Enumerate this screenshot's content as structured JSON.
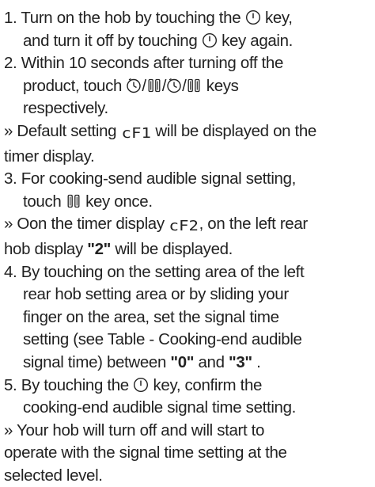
{
  "icons": {
    "power": "power-key-icon",
    "timer": "timer-key-icon",
    "lock": "lock-key-icon"
  },
  "codes": {
    "cf1": "cF1",
    "cf2": "cF2"
  },
  "step1": {
    "l1a": "1. Turn on the hob by touching the ",
    "l1b": " key,",
    "l2a": "and turn it off by touching ",
    "l2b": " key again."
  },
  "step2": {
    "l1": "2. Within 10 seconds after turning off the",
    "l2a": "product, touch ",
    "sep1": "/",
    "sep2": "/",
    "sep3": "/",
    "l2b": " keys",
    "l3": "respectively."
  },
  "note1": {
    "l1a": "» Default setting ",
    "l1b": " will be displayed on the",
    "l2": "timer display."
  },
  "step3": {
    "l1": "3. For cooking-send audible signal setting,",
    "l2a": "touch ",
    "l2b": " key once."
  },
  "note2": {
    "l1a": "» Oon the timer display ",
    "l1b": ", on the left rear",
    "l2a": "hob display ",
    "l2b": "\"2\"",
    "l2c": " will be displayed."
  },
  "step4": {
    "l1": "4. By touching on the setting area of the left",
    "l2": "rear hob setting area or by sliding your",
    "l3": "finger on the area, set the signal time",
    "l4": "setting (see Table - Cooking-end audible",
    "l5a": "signal time) between ",
    "l5b": "\"0\"",
    "l5c": " and ",
    "l5d": "\"3\"",
    "l5e": " ."
  },
  "step5": {
    "l1a": "5. By touching the ",
    "l1b": " key, confirm the",
    "l2": "cooking-end audible signal time setting."
  },
  "note3": {
    "l1": "» Your hob will turn off and will start to",
    "l2": "operate with the signal time setting at the",
    "l3": "selected level."
  }
}
